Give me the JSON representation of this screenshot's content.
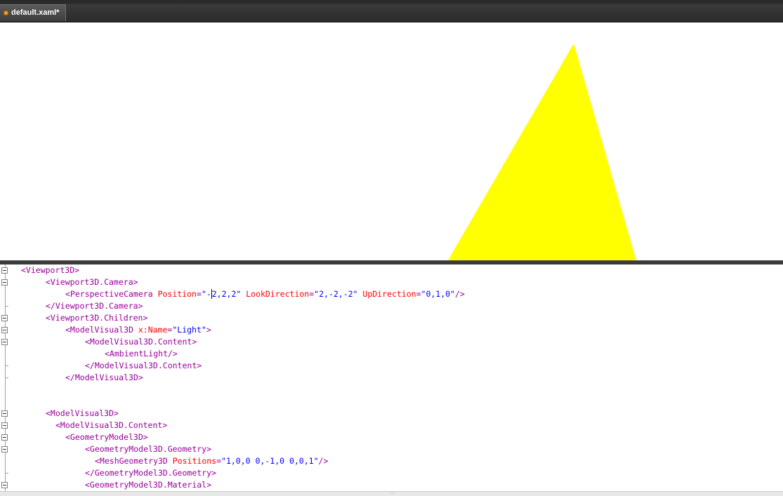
{
  "tabs": [
    {
      "label": "default.xaml*",
      "modified": true
    }
  ],
  "colors": {
    "tab_modified_dot": "#f0a020",
    "triangle": "#ffff00",
    "xml_tag": "#990099",
    "xml_attr": "#ff0000",
    "xml_value": "#0000ff"
  },
  "editor": {
    "lines": [
      {
        "indent": 0,
        "fold": "box",
        "parts": [
          [
            "tag",
            "<Viewport3D>"
          ]
        ]
      },
      {
        "indent": 5,
        "fold": "box",
        "parts": [
          [
            "tag",
            "<Viewport3D.Camera>"
          ]
        ]
      },
      {
        "indent": 9,
        "fold": "line",
        "parts": [
          [
            "tag",
            "<PerspectiveCamera "
          ],
          [
            "attr",
            "Position"
          ],
          [
            "tag",
            "="
          ],
          [
            "val",
            "\"-"
          ],
          [
            "caret",
            ""
          ],
          [
            "val",
            "2,2,2\""
          ],
          [
            "attr",
            " LookDirection"
          ],
          [
            "tag",
            "="
          ],
          [
            "val",
            "\"2,-2,-2\""
          ],
          [
            "attr",
            " UpDirection"
          ],
          [
            "tag",
            "="
          ],
          [
            "val",
            "\"0,1,0\""
          ],
          [
            "tag",
            "/>"
          ]
        ]
      },
      {
        "indent": 5,
        "fold": "tick",
        "parts": [
          [
            "tag",
            "</Viewport3D.Camera>"
          ]
        ]
      },
      {
        "indent": 5,
        "fold": "box",
        "parts": [
          [
            "tag",
            "<Viewport3D.Children>"
          ]
        ]
      },
      {
        "indent": 9,
        "fold": "box",
        "parts": [
          [
            "tag",
            "<ModelVisual3D "
          ],
          [
            "attr",
            "x:Name"
          ],
          [
            "tag",
            "="
          ],
          [
            "val",
            "\"Light\""
          ],
          [
            "tag",
            ">"
          ]
        ]
      },
      {
        "indent": 13,
        "fold": "box",
        "parts": [
          [
            "tag",
            "<ModelVisual3D.Content>"
          ]
        ]
      },
      {
        "indent": 17,
        "fold": "line",
        "parts": [
          [
            "tag",
            "<AmbientLight/>"
          ]
        ]
      },
      {
        "indent": 13,
        "fold": "tick",
        "parts": [
          [
            "tag",
            "</ModelVisual3D.Content>"
          ]
        ]
      },
      {
        "indent": 9,
        "fold": "tick",
        "parts": [
          [
            "tag",
            "</ModelVisual3D>"
          ]
        ]
      },
      {
        "indent": 0,
        "fold": "line",
        "parts": []
      },
      {
        "indent": 0,
        "fold": "line",
        "parts": []
      },
      {
        "indent": 5,
        "fold": "box",
        "parts": [
          [
            "tag",
            "<ModelVisual3D>"
          ]
        ]
      },
      {
        "indent": 7,
        "fold": "box",
        "parts": [
          [
            "tag",
            "<ModelVisual3D.Content>"
          ]
        ]
      },
      {
        "indent": 9,
        "fold": "box",
        "parts": [
          [
            "tag",
            "<GeometryModel3D>"
          ]
        ]
      },
      {
        "indent": 13,
        "fold": "box",
        "parts": [
          [
            "tag",
            "<GeometryModel3D.Geometry>"
          ]
        ]
      },
      {
        "indent": 15,
        "fold": "line",
        "parts": [
          [
            "tag",
            "<MeshGeometry3D "
          ],
          [
            "attr",
            "Positions"
          ],
          [
            "tag",
            "="
          ],
          [
            "val",
            "\"1,0,0 0,-1,0 0,0,1\""
          ],
          [
            "tag",
            "/>"
          ]
        ]
      },
      {
        "indent": 13,
        "fold": "tick",
        "parts": [
          [
            "tag",
            "</GeometryModel3D.Geometry>"
          ]
        ]
      },
      {
        "indent": 13,
        "fold": "box",
        "parts": [
          [
            "tag",
            "<GeometryModel3D.Material>"
          ]
        ]
      }
    ]
  }
}
